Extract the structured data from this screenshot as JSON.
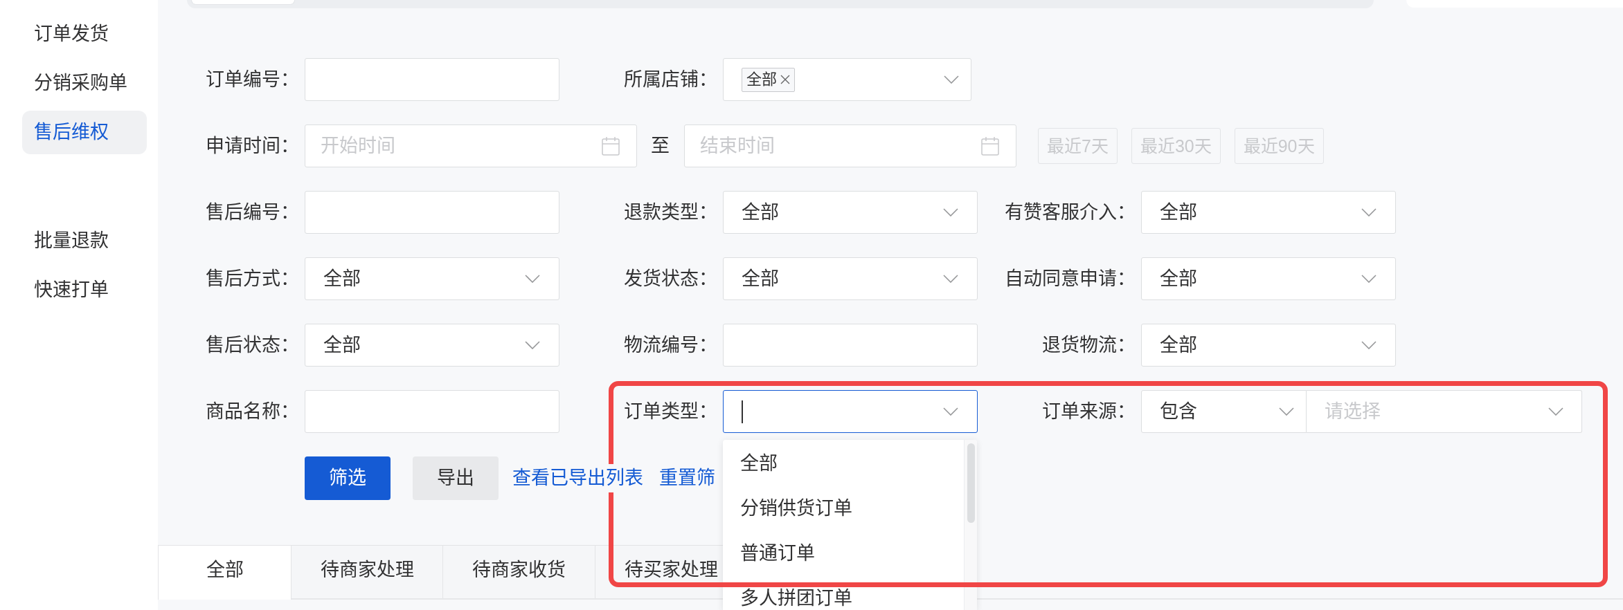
{
  "sidebar": {
    "groups": [
      {
        "items": [
          {
            "label": "订单发货",
            "selected": false
          },
          {
            "label": "分销采购单",
            "selected": false
          },
          {
            "label": "售后维权",
            "selected": true
          }
        ]
      },
      {
        "items": [
          {
            "label": "批量退款",
            "selected": false
          },
          {
            "label": "快速打单",
            "selected": false
          }
        ]
      }
    ]
  },
  "filter_rows": [
    {
      "fields": [
        {
          "kind": "input",
          "label": "订单编号："
        },
        {
          "kind": "tag-select",
          "label": "所属店铺：",
          "tags": [
            "全部"
          ],
          "expanded": false
        }
      ]
    },
    {
      "fields": [
        {
          "kind": "date-range",
          "label": "申请时间：",
          "start_placeholder": "开始时间",
          "separator": "至",
          "end_placeholder": "结束时间",
          "shortcuts": [
            {
              "label": "最近7天",
              "disabled": true
            },
            {
              "label": "最近30天",
              "disabled": true
            },
            {
              "label": "最近90天",
              "disabled": true
            }
          ]
        }
      ]
    },
    {
      "fields": [
        {
          "kind": "input",
          "label": "售后编号："
        },
        {
          "kind": "select",
          "label": "退款类型：",
          "value": "全部",
          "expanded": false
        },
        {
          "kind": "select",
          "label": "有赞客服介入：",
          "value": "全部",
          "expanded": false
        }
      ]
    },
    {
      "fields": [
        {
          "kind": "select",
          "label": "售后方式：",
          "value": "全部",
          "expanded": false
        },
        {
          "kind": "select",
          "label": "发货状态：",
          "value": "全部",
          "expanded": false
        },
        {
          "kind": "select",
          "label": "自动同意申请：",
          "value": "全部",
          "expanded": false
        }
      ]
    },
    {
      "fields": [
        {
          "kind": "select",
          "label": "售后状态：",
          "value": "全部",
          "expanded": false
        },
        {
          "kind": "input",
          "label": "物流编号："
        },
        {
          "kind": "select",
          "label": "退货物流：",
          "value": "全部",
          "expanded": false
        }
      ]
    },
    {
      "fields": [
        {
          "kind": "input",
          "label": "商品名称："
        },
        {
          "kind": "select",
          "label": "订单类型：",
          "expanded": true,
          "options": [
            "全部",
            "分销供货订单",
            "普通订单",
            "多人拼团订单"
          ]
        },
        {
          "kind": "combo",
          "label": "订单来源：",
          "mode": "包含",
          "placeholder": "请选择"
        }
      ]
    }
  ],
  "actions": {
    "buttons": [
      {
        "label": "筛选",
        "kind": "primary"
      },
      {
        "label": "导出",
        "kind": "secondary"
      }
    ],
    "links": [
      "查看已导出列表",
      "重置筛"
    ]
  },
  "tabs": [
    {
      "label": "全部",
      "selected": true
    },
    {
      "label": "待商家处理",
      "selected": false
    },
    {
      "label": "待商家收货",
      "selected": false
    },
    {
      "label": "待买家处理",
      "selected": false
    }
  ]
}
